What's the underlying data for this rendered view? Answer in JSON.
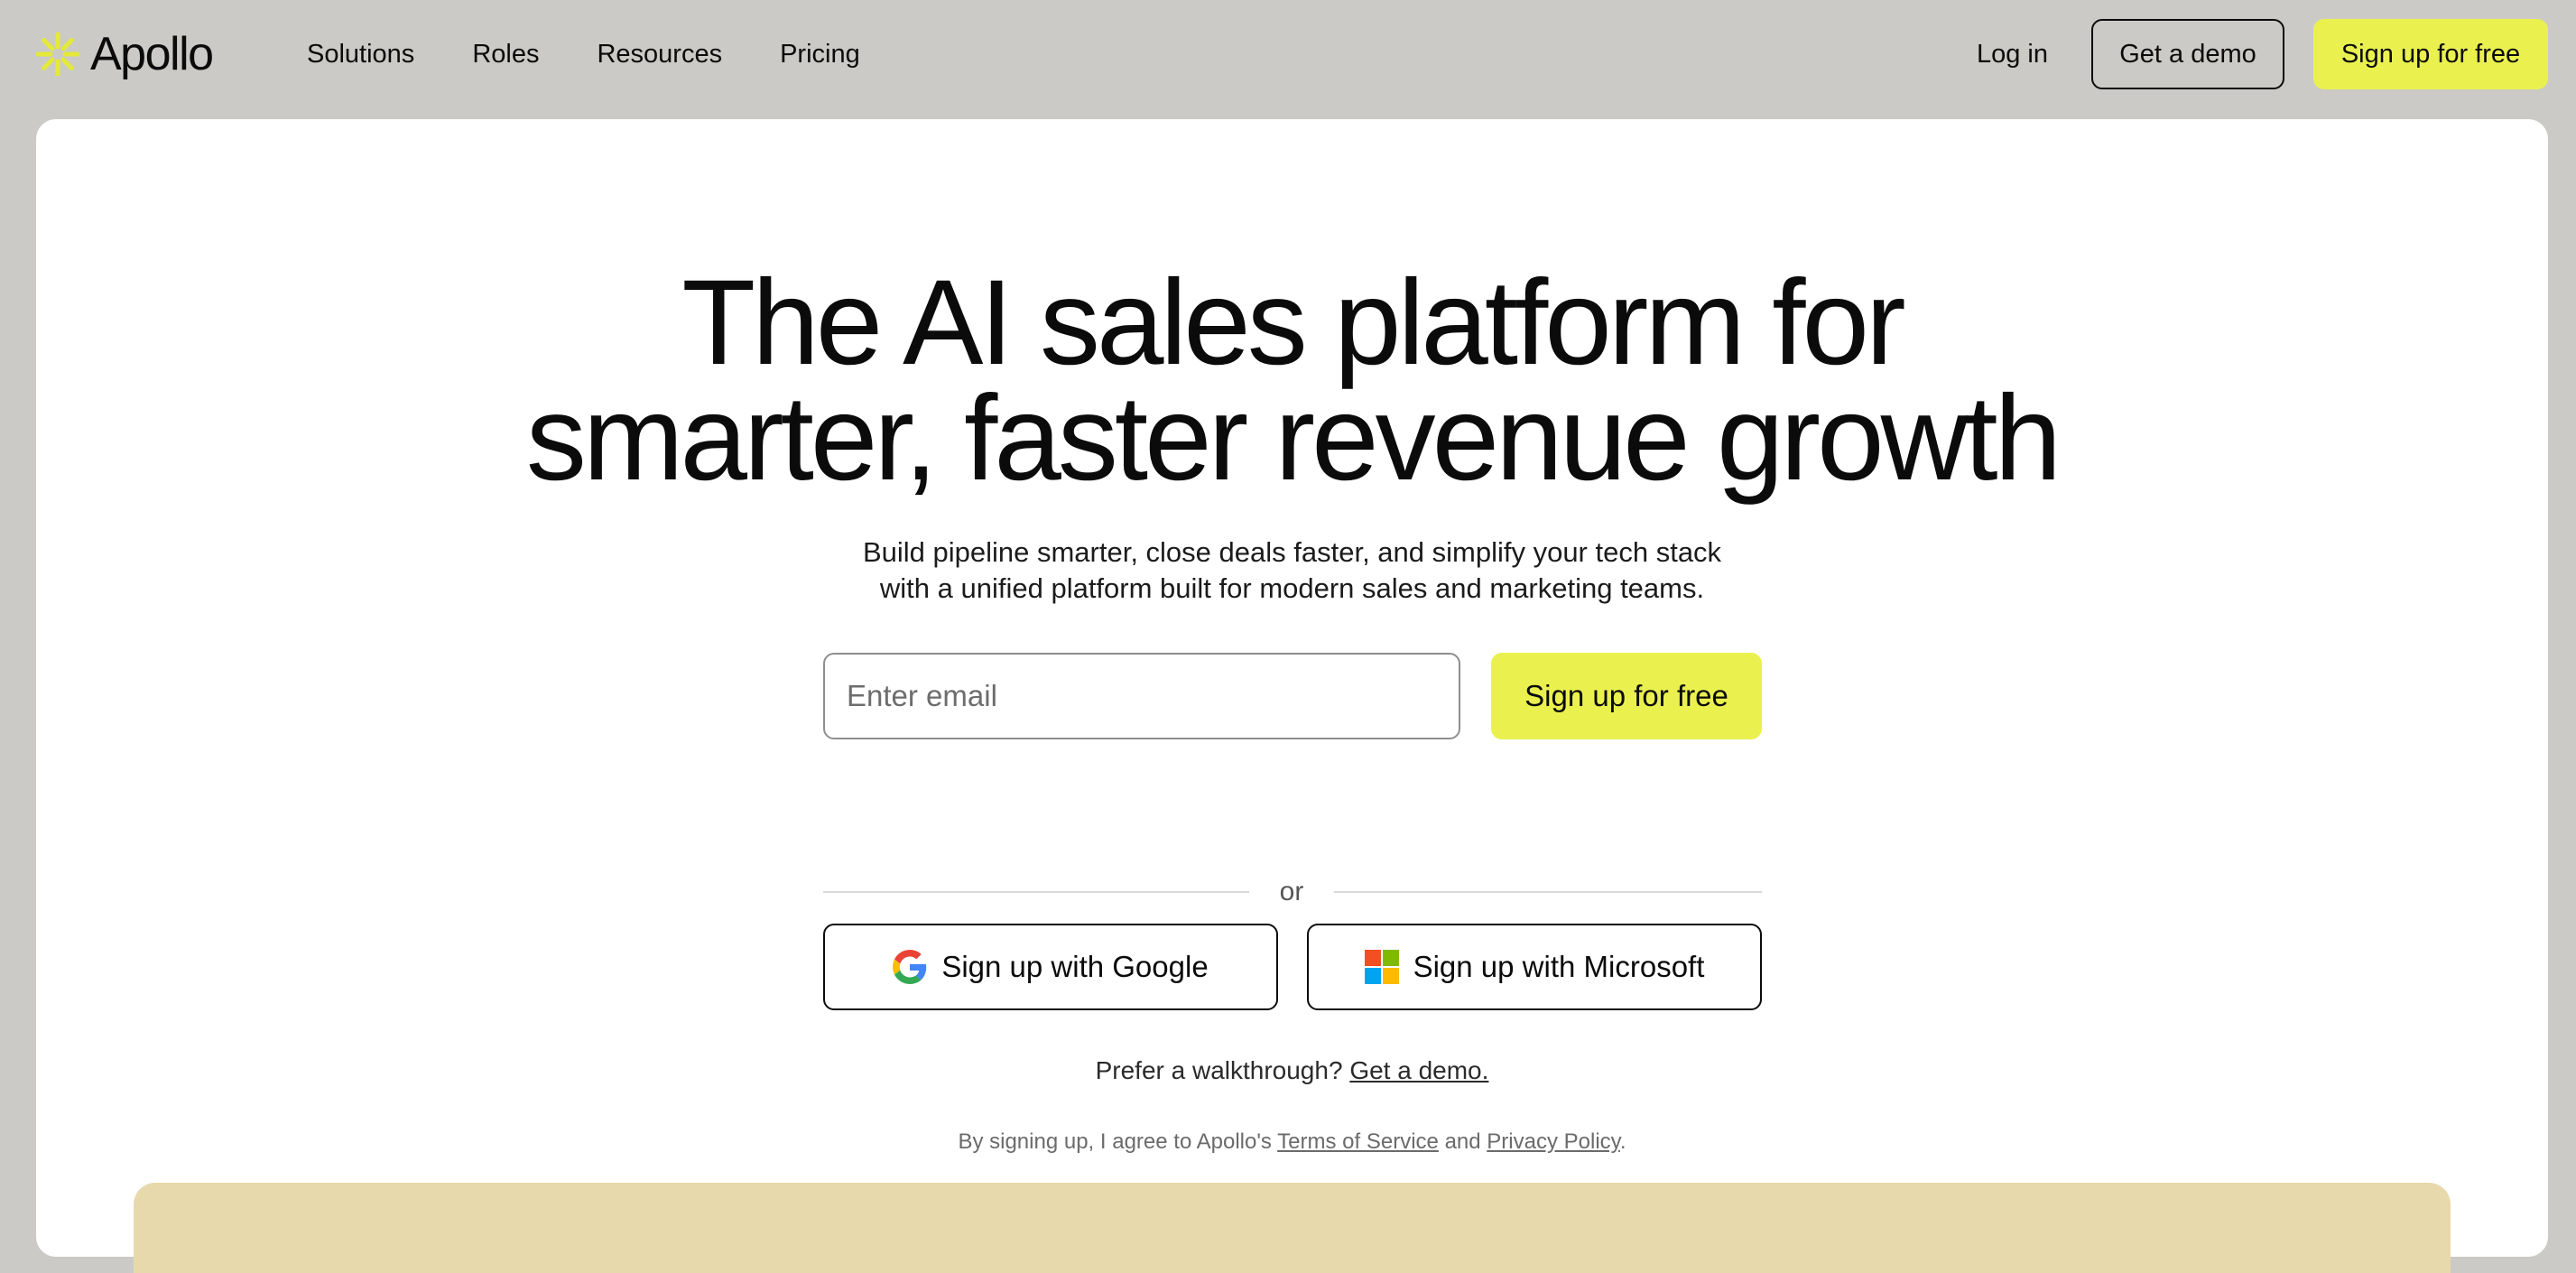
{
  "brand": {
    "name": "Apollo",
    "accent_color": "#eaf14f",
    "logo_icon": "apollo-asterisk-logo"
  },
  "nav": {
    "links": [
      "Solutions",
      "Roles",
      "Resources",
      "Pricing"
    ],
    "login_label": "Log in",
    "demo_label": "Get a demo",
    "signup_label": "Sign up for free"
  },
  "hero": {
    "title_line1": "The AI sales platform for",
    "title_line2": "smarter, faster revenue growth",
    "subtitle_line1": "Build pipeline smarter, close deals faster, and simplify your tech stack",
    "subtitle_line2": "with a unified platform built for modern sales and marketing teams."
  },
  "signup_form": {
    "email_placeholder": "Enter email",
    "email_value": "",
    "submit_label": "Sign up for free",
    "divider_text": "or",
    "google_label": "Sign up with Google",
    "microsoft_label": "Sign up with Microsoft",
    "google_icon": "google-g-icon",
    "microsoft_icon": "microsoft-logo-icon"
  },
  "walkthrough": {
    "prefix": "Prefer a walkthrough?",
    "link_label": "Get a demo."
  },
  "legal": {
    "prefix": "By signing up, I agree to Apollo's",
    "terms_label": "Terms of Service",
    "conjunction": "and",
    "privacy_label": "Privacy Policy",
    "suffix": "."
  },
  "colors": {
    "page_background": "#cbcac6",
    "card_background": "#ffffff",
    "preview_panel": "#e7d9ac"
  }
}
